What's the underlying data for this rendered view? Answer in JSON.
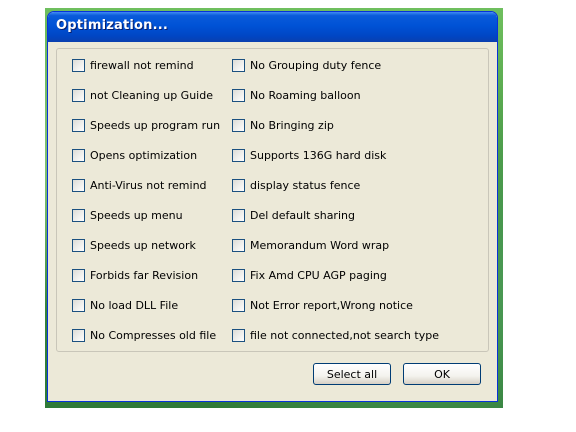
{
  "window": {
    "title": "Optimization..."
  },
  "options": {
    "left": [
      {
        "label": "firewall not remind",
        "checked": false
      },
      {
        "label": "not Cleaning up Guide",
        "checked": false
      },
      {
        "label": "Speeds up program run",
        "checked": false
      },
      {
        "label": "Opens optimization",
        "checked": false
      },
      {
        "label": "Anti-Virus not remind",
        "checked": false
      },
      {
        "label": "Speeds up menu",
        "checked": false
      },
      {
        "label": "Speeds up network",
        "checked": false
      },
      {
        "label": "Forbids far Revision",
        "checked": false
      },
      {
        "label": "No load DLL File",
        "checked": false
      },
      {
        "label": "No Compresses old file",
        "checked": false
      }
    ],
    "right": [
      {
        "label": "No Grouping duty fence",
        "checked": false
      },
      {
        "label": "No Roaming balloon",
        "checked": false
      },
      {
        "label": "No Bringing zip",
        "checked": false
      },
      {
        "label": "Supports 136G hard disk",
        "checked": false
      },
      {
        "label": "display status fence",
        "checked": false
      },
      {
        "label": "Del default sharing",
        "checked": false
      },
      {
        "label": "Memorandum Word wrap",
        "checked": false
      },
      {
        "label": "Fix Amd CPU AGP paging",
        "checked": false
      },
      {
        "label": "Not Error report,Wrong notice",
        "checked": false
      },
      {
        "label": "file not connected,not search type",
        "checked": false
      }
    ]
  },
  "buttons": {
    "select_all": "Select all",
    "ok": "OK"
  }
}
